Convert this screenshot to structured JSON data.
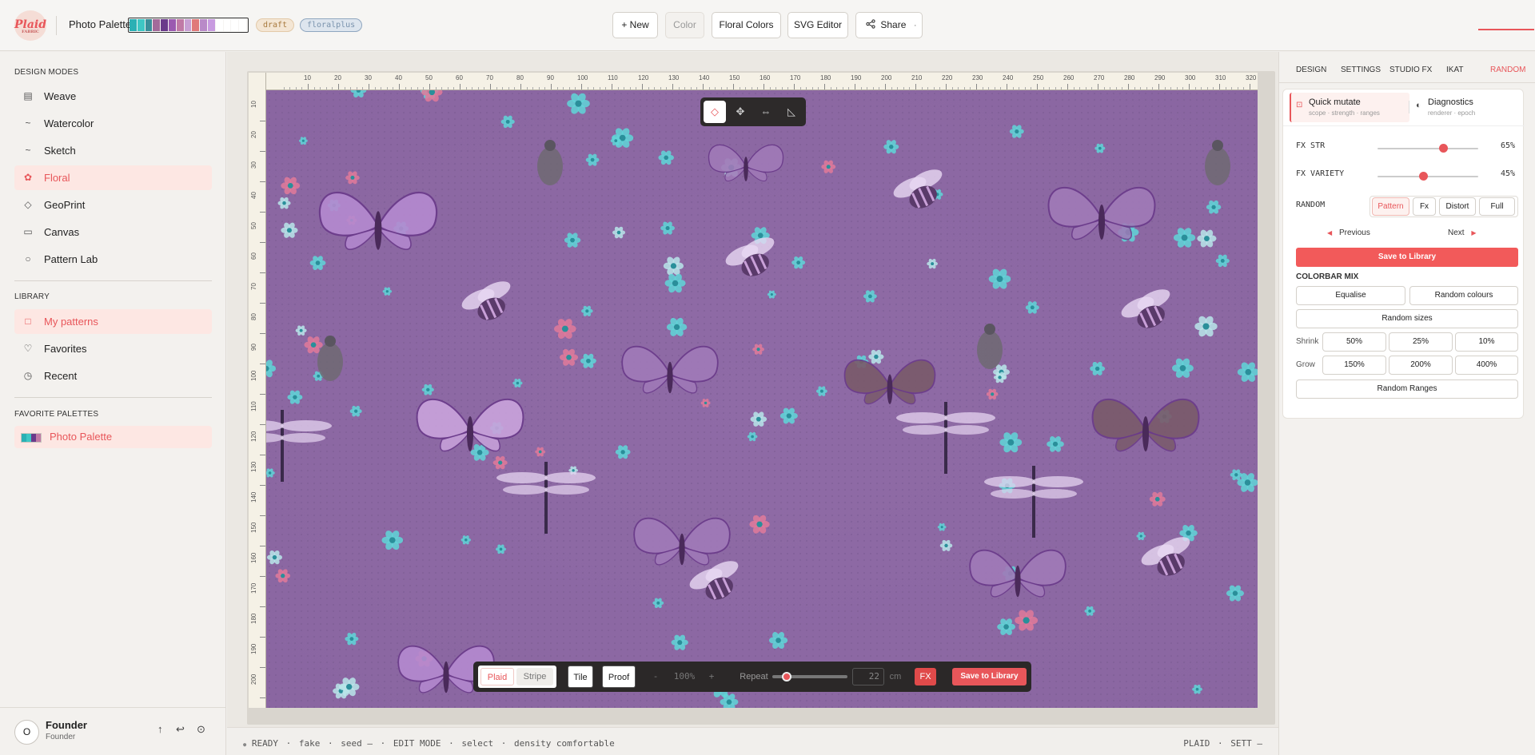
{
  "app": {
    "logo_text": "Plaid",
    "logo_sub": "FABRIC",
    "palette_name": "Photo Palette",
    "palette_swatches": [
      "#2bb0b4",
      "#3ec7c4",
      "#3a8f9a",
      "#a36a9a",
      "#6a3a8a",
      "#9b5ab0",
      "#c07aa6",
      "#c8a0d4",
      "#e07a7a",
      "#b98ac8",
      "#c89be0",
      "#ffffff",
      "#ffffff",
      "#ffffff",
      "#ffffff"
    ],
    "badge_draft": "draft",
    "badge_plus": "floralplus"
  },
  "toolbar": {
    "new_label": "+ New",
    "color_label": "Color",
    "floral_colors_label": "Floral Colors",
    "svg_editor_label": "SVG Editor",
    "share_label": "Share",
    "share_caret": "·"
  },
  "sidebar": {
    "design_modes_title": "DESIGN MODES",
    "modes": [
      {
        "label": "Weave",
        "icon": "▤"
      },
      {
        "label": "Watercolor",
        "icon": "~"
      },
      {
        "label": "Sketch",
        "icon": "~"
      },
      {
        "label": "Floral",
        "icon": "✿"
      },
      {
        "label": "GeoPrint",
        "icon": "◇"
      },
      {
        "label": "Canvas",
        "icon": "▭"
      },
      {
        "label": "Pattern Lab",
        "icon": "○"
      }
    ],
    "library_title": "LIBRARY",
    "library": [
      {
        "label": "My patterns",
        "icon": "□"
      },
      {
        "label": "Favorites",
        "icon": "♡"
      },
      {
        "label": "Recent",
        "icon": "◷"
      }
    ],
    "favorites_title": "FAVORITE PALETTES",
    "favorite_palette": "Photo Palette",
    "fav_swatches": [
      "#2bb0b4",
      "#3ec7c4",
      "#6a3a8a",
      "#c07aa6"
    ],
    "user_initial": "O",
    "user_name": "Founder",
    "user_role": "Founder",
    "user_icons": [
      "↑",
      "↩",
      "⊙"
    ]
  },
  "ruler": {
    "unit": "mm",
    "top_ticks": [
      "10",
      "20",
      "30",
      "40",
      "50",
      "60",
      "70",
      "80",
      "90",
      "100",
      "110",
      "120",
      "130",
      "140",
      "150",
      "160",
      "170",
      "180",
      "190",
      "200",
      "210",
      "220",
      "230",
      "240",
      "250",
      "260",
      "270",
      "280",
      "290",
      "300",
      "310",
      "320"
    ],
    "left_ticks": [
      "10",
      "20",
      "30",
      "40",
      "50",
      "60",
      "70",
      "80",
      "90",
      "100",
      "110",
      "120",
      "130",
      "140",
      "150",
      "160",
      "170",
      "180",
      "190",
      "200"
    ]
  },
  "canvas_tools": {
    "icons": [
      "◇",
      "✥",
      "⇔",
      "◺"
    ]
  },
  "dock": {
    "plaid_label": "Plaid",
    "stripe_label": "Stripe",
    "tile_label": "Tile",
    "proof_label": "Proof",
    "minus": "-",
    "zoom": "100%",
    "plus": "+",
    "repeat_label": "Repeat",
    "repeat_value": "22",
    "repeat_unit": "cm",
    "fx_label": "FX",
    "save_label": "Save to Library"
  },
  "status": {
    "dot": "●",
    "ready": "READY",
    "mode": "fake",
    "seed": "seed –",
    "edit": "EDIT MODE",
    "tool": "select",
    "density": "density comfortable",
    "sep": "·",
    "right_a": "PLAID",
    "right_b": "SETT –"
  },
  "rightpanel": {
    "tabs": [
      "DESIGN",
      "SETTINGS",
      "STUDIO FX",
      "IKAT",
      "RANDOM"
    ],
    "quick_mutate_title": "Quick mutate",
    "quick_mutate_sub": "scope · strength · ranges",
    "diagnostics_title": "Diagnostics",
    "diagnostics_sub": "renderer · epoch",
    "fx_str_label": "FX STR",
    "fx_str_value": "65%",
    "fx_str_level": 0.65,
    "fx_variety_label": "FX VARIETY",
    "fx_variety_value": "45%",
    "fx_variety_level": 0.45,
    "random_label": "RANDOM",
    "random_options": [
      "Pattern",
      "Fx",
      "Distort",
      "Full"
    ],
    "prev_label": "Previous",
    "next_label": "Next",
    "save_label": "Save to Library",
    "colorbar_title": "COLORBAR MIX",
    "equalise": "Equalise",
    "random_colours": "Random colours",
    "random_sizes": "Random sizes",
    "shrink_label": "Shrink",
    "shrink_options": [
      "50%",
      "25%",
      "10%"
    ],
    "grow_label": "Grow",
    "grow_options": [
      "150%",
      "200%",
      "400%"
    ],
    "random_ranges": "Random Ranges"
  }
}
